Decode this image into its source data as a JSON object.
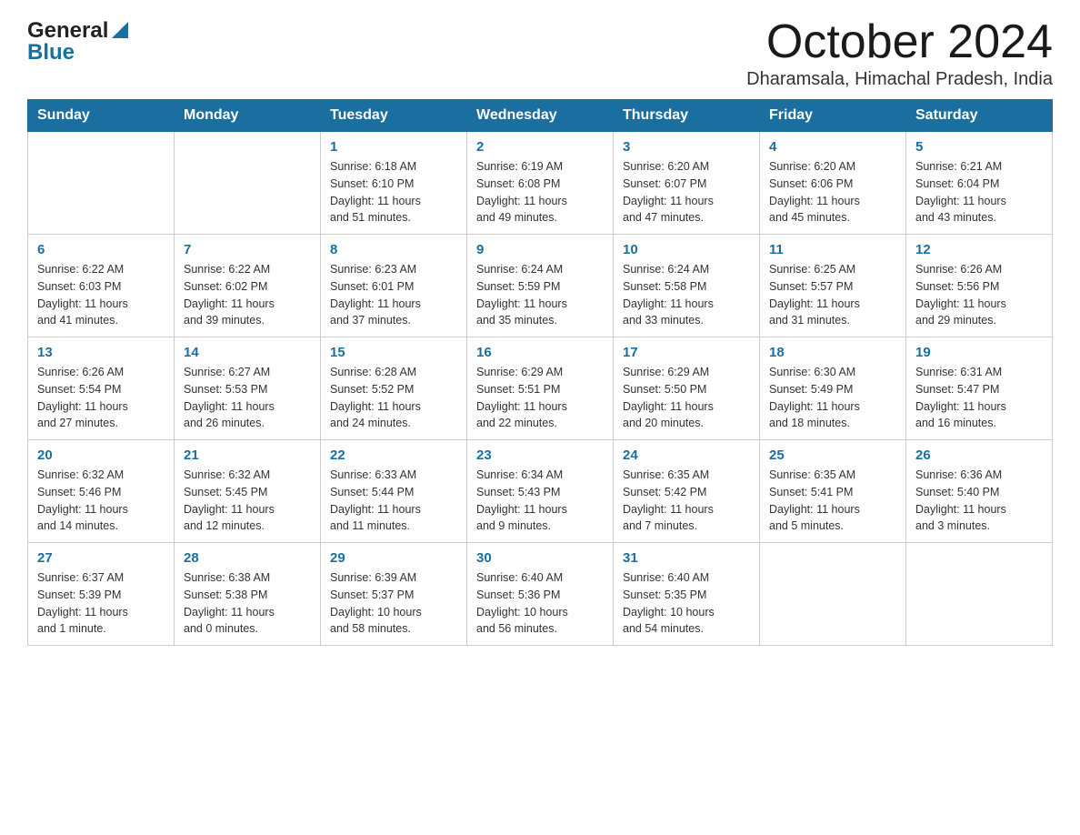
{
  "header": {
    "logo_general": "General",
    "logo_blue": "Blue",
    "month_title": "October 2024",
    "location": "Dharamsala, Himachal Pradesh, India"
  },
  "days_of_week": [
    "Sunday",
    "Monday",
    "Tuesday",
    "Wednesday",
    "Thursday",
    "Friday",
    "Saturday"
  ],
  "weeks": [
    [
      {
        "num": "",
        "info": ""
      },
      {
        "num": "",
        "info": ""
      },
      {
        "num": "1",
        "info": "Sunrise: 6:18 AM\nSunset: 6:10 PM\nDaylight: 11 hours\nand 51 minutes."
      },
      {
        "num": "2",
        "info": "Sunrise: 6:19 AM\nSunset: 6:08 PM\nDaylight: 11 hours\nand 49 minutes."
      },
      {
        "num": "3",
        "info": "Sunrise: 6:20 AM\nSunset: 6:07 PM\nDaylight: 11 hours\nand 47 minutes."
      },
      {
        "num": "4",
        "info": "Sunrise: 6:20 AM\nSunset: 6:06 PM\nDaylight: 11 hours\nand 45 minutes."
      },
      {
        "num": "5",
        "info": "Sunrise: 6:21 AM\nSunset: 6:04 PM\nDaylight: 11 hours\nand 43 minutes."
      }
    ],
    [
      {
        "num": "6",
        "info": "Sunrise: 6:22 AM\nSunset: 6:03 PM\nDaylight: 11 hours\nand 41 minutes."
      },
      {
        "num": "7",
        "info": "Sunrise: 6:22 AM\nSunset: 6:02 PM\nDaylight: 11 hours\nand 39 minutes."
      },
      {
        "num": "8",
        "info": "Sunrise: 6:23 AM\nSunset: 6:01 PM\nDaylight: 11 hours\nand 37 minutes."
      },
      {
        "num": "9",
        "info": "Sunrise: 6:24 AM\nSunset: 5:59 PM\nDaylight: 11 hours\nand 35 minutes."
      },
      {
        "num": "10",
        "info": "Sunrise: 6:24 AM\nSunset: 5:58 PM\nDaylight: 11 hours\nand 33 minutes."
      },
      {
        "num": "11",
        "info": "Sunrise: 6:25 AM\nSunset: 5:57 PM\nDaylight: 11 hours\nand 31 minutes."
      },
      {
        "num": "12",
        "info": "Sunrise: 6:26 AM\nSunset: 5:56 PM\nDaylight: 11 hours\nand 29 minutes."
      }
    ],
    [
      {
        "num": "13",
        "info": "Sunrise: 6:26 AM\nSunset: 5:54 PM\nDaylight: 11 hours\nand 27 minutes."
      },
      {
        "num": "14",
        "info": "Sunrise: 6:27 AM\nSunset: 5:53 PM\nDaylight: 11 hours\nand 26 minutes."
      },
      {
        "num": "15",
        "info": "Sunrise: 6:28 AM\nSunset: 5:52 PM\nDaylight: 11 hours\nand 24 minutes."
      },
      {
        "num": "16",
        "info": "Sunrise: 6:29 AM\nSunset: 5:51 PM\nDaylight: 11 hours\nand 22 minutes."
      },
      {
        "num": "17",
        "info": "Sunrise: 6:29 AM\nSunset: 5:50 PM\nDaylight: 11 hours\nand 20 minutes."
      },
      {
        "num": "18",
        "info": "Sunrise: 6:30 AM\nSunset: 5:49 PM\nDaylight: 11 hours\nand 18 minutes."
      },
      {
        "num": "19",
        "info": "Sunrise: 6:31 AM\nSunset: 5:47 PM\nDaylight: 11 hours\nand 16 minutes."
      }
    ],
    [
      {
        "num": "20",
        "info": "Sunrise: 6:32 AM\nSunset: 5:46 PM\nDaylight: 11 hours\nand 14 minutes."
      },
      {
        "num": "21",
        "info": "Sunrise: 6:32 AM\nSunset: 5:45 PM\nDaylight: 11 hours\nand 12 minutes."
      },
      {
        "num": "22",
        "info": "Sunrise: 6:33 AM\nSunset: 5:44 PM\nDaylight: 11 hours\nand 11 minutes."
      },
      {
        "num": "23",
        "info": "Sunrise: 6:34 AM\nSunset: 5:43 PM\nDaylight: 11 hours\nand 9 minutes."
      },
      {
        "num": "24",
        "info": "Sunrise: 6:35 AM\nSunset: 5:42 PM\nDaylight: 11 hours\nand 7 minutes."
      },
      {
        "num": "25",
        "info": "Sunrise: 6:35 AM\nSunset: 5:41 PM\nDaylight: 11 hours\nand 5 minutes."
      },
      {
        "num": "26",
        "info": "Sunrise: 6:36 AM\nSunset: 5:40 PM\nDaylight: 11 hours\nand 3 minutes."
      }
    ],
    [
      {
        "num": "27",
        "info": "Sunrise: 6:37 AM\nSunset: 5:39 PM\nDaylight: 11 hours\nand 1 minute."
      },
      {
        "num": "28",
        "info": "Sunrise: 6:38 AM\nSunset: 5:38 PM\nDaylight: 11 hours\nand 0 minutes."
      },
      {
        "num": "29",
        "info": "Sunrise: 6:39 AM\nSunset: 5:37 PM\nDaylight: 10 hours\nand 58 minutes."
      },
      {
        "num": "30",
        "info": "Sunrise: 6:40 AM\nSunset: 5:36 PM\nDaylight: 10 hours\nand 56 minutes."
      },
      {
        "num": "31",
        "info": "Sunrise: 6:40 AM\nSunset: 5:35 PM\nDaylight: 10 hours\nand 54 minutes."
      },
      {
        "num": "",
        "info": ""
      },
      {
        "num": "",
        "info": ""
      }
    ]
  ]
}
